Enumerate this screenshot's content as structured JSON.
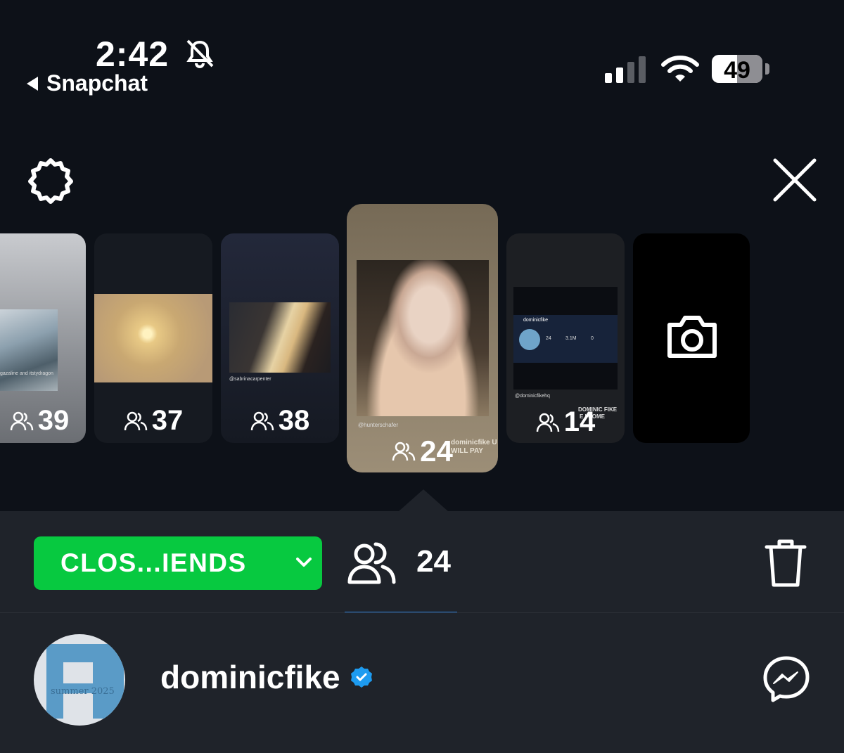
{
  "status_bar": {
    "time": "2:42",
    "back_app": "Snapchat",
    "battery": "49",
    "bell_icon": "bell-slash-icon",
    "signal_icon": "cellular-signal-icon",
    "wifi_icon": "wifi-icon"
  },
  "top_bar": {
    "settings_icon": "gear-icon",
    "close_icon": "close-icon"
  },
  "stories": [
    {
      "views": "39",
      "caption": "gazaline and itstydragon"
    },
    {
      "views": "37",
      "caption": ""
    },
    {
      "views": "38",
      "caption": "@sabrinacarpenter"
    },
    {
      "views": "24",
      "caption": "@hunterschafer",
      "overlay_line1": "dominicfike U",
      "overlay_line2": "WILL PAY",
      "selected": true
    },
    {
      "views": "14",
      "caption": "@dominicfikehq",
      "overlay_line1": "DOMINIC FIKE",
      "overlay_line2": "E I COME",
      "profile_name": "dominicfike",
      "stats": [
        "24",
        "3.1M",
        "0"
      ]
    },
    {
      "type": "camera",
      "icon": "camera-icon"
    }
  ],
  "sheet": {
    "audience": "CLOS...IENDS",
    "viewers": "24",
    "delete_icon": "trash-icon"
  },
  "profile": {
    "username": "dominicfike",
    "verified": true,
    "avatar_text": "summer 2025",
    "accent": "#07c940"
  }
}
